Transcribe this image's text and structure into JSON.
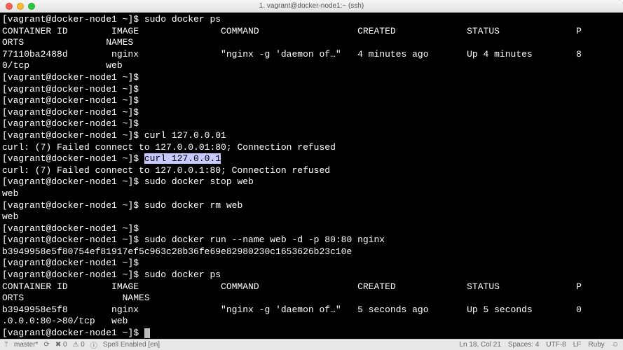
{
  "window": {
    "title": "1. vagrant@docker-node1:~ (ssh)"
  },
  "terminal": {
    "lines": [
      {
        "t": "prompt_cmd",
        "prompt": "[vagrant@docker-node1 ~]$ ",
        "cmd": "sudo docker ps"
      },
      {
        "t": "text",
        "text": "CONTAINER ID        IMAGE               COMMAND                  CREATED             STATUS              P"
      },
      {
        "t": "text",
        "text": "ORTS               NAMES"
      },
      {
        "t": "text",
        "text": "77110ba2488d        nginx               \"nginx -g 'daemon of…\"   4 minutes ago       Up 4 minutes        8"
      },
      {
        "t": "text",
        "text": "0/tcp              web"
      },
      {
        "t": "prompt_cmd",
        "prompt": "[vagrant@docker-node1 ~]$ ",
        "cmd": ""
      },
      {
        "t": "prompt_cmd",
        "prompt": "[vagrant@docker-node1 ~]$ ",
        "cmd": ""
      },
      {
        "t": "prompt_cmd",
        "prompt": "[vagrant@docker-node1 ~]$ ",
        "cmd": ""
      },
      {
        "t": "prompt_cmd",
        "prompt": "[vagrant@docker-node1 ~]$ ",
        "cmd": ""
      },
      {
        "t": "prompt_cmd",
        "prompt": "[vagrant@docker-node1 ~]$ ",
        "cmd": ""
      },
      {
        "t": "prompt_cmd",
        "prompt": "[vagrant@docker-node1 ~]$ ",
        "cmd": "curl 127.0.0.01"
      },
      {
        "t": "text",
        "text": "curl: (7) Failed connect to 127.0.0.01:80; Connection refused"
      },
      {
        "t": "prompt_hl",
        "prompt": "[vagrant@docker-node1 ~]$ ",
        "cmd": "curl 127.0.0.1"
      },
      {
        "t": "text",
        "text": "curl: (7) Failed connect to 127.0.0.1:80; Connection refused"
      },
      {
        "t": "prompt_cmd",
        "prompt": "[vagrant@docker-node1 ~]$ ",
        "cmd": "sudo docker stop web"
      },
      {
        "t": "text",
        "text": "web"
      },
      {
        "t": "prompt_cmd",
        "prompt": "[vagrant@docker-node1 ~]$ ",
        "cmd": "sudo docker rm web"
      },
      {
        "t": "text",
        "text": "web"
      },
      {
        "t": "prompt_cmd",
        "prompt": "[vagrant@docker-node1 ~]$ ",
        "cmd": ""
      },
      {
        "t": "prompt_cmd",
        "prompt": "[vagrant@docker-node1 ~]$ ",
        "cmd": "sudo docker run --name web -d -p 80:80 nginx"
      },
      {
        "t": "text",
        "text": "b3949958e5f80754ef81917ef5c963c28b36fe69e82980230c1653626b23c10e"
      },
      {
        "t": "prompt_cmd",
        "prompt": "[vagrant@docker-node1 ~]$ ",
        "cmd": ""
      },
      {
        "t": "prompt_cmd",
        "prompt": "[vagrant@docker-node1 ~]$ ",
        "cmd": "sudo docker ps"
      },
      {
        "t": "text",
        "text": "CONTAINER ID        IMAGE               COMMAND                  CREATED             STATUS              P"
      },
      {
        "t": "text",
        "text": "ORTS                  NAMES"
      },
      {
        "t": "text",
        "text": "b3949958e5f8        nginx               \"nginx -g 'daemon of…\"   5 seconds ago       Up 5 seconds        0"
      },
      {
        "t": "text",
        "text": ".0.0.0:80->80/tcp   web"
      },
      {
        "t": "prompt_cursor",
        "prompt": "[vagrant@docker-node1 ~]$ "
      }
    ]
  },
  "statusbar": {
    "branch": "master*",
    "sync": "⟳",
    "errors": "✖ 0",
    "warnings": "⚠ 0",
    "spell": "Spell Enabled [en]",
    "position": "Ln 18, Col 21",
    "spaces": "Spaces: 4",
    "encoding": "UTF-8",
    "eol": "LF",
    "lang": "Ruby",
    "feedback": "☺"
  }
}
